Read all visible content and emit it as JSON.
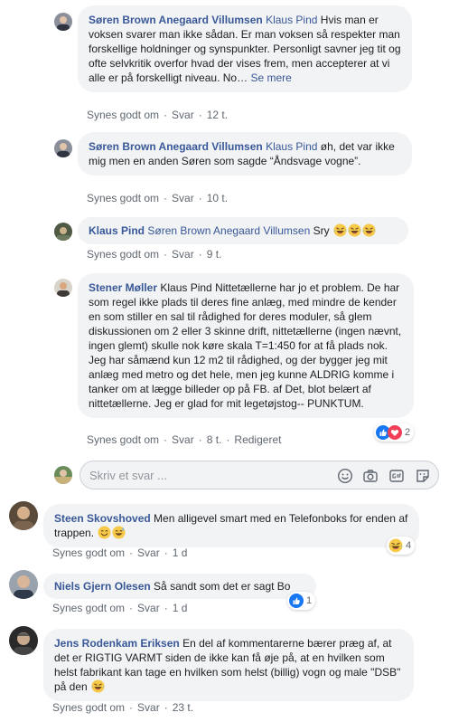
{
  "comments": [
    {
      "author": "Søren Brown Anegaard Villumsen",
      "mention": "Klaus Pind",
      "text": " Hvis man er voksen svarer man ikke sådan. Er man voksen så respekter man forskellige holdninger og synspunkter. Personligt savner jeg tit og ofte selvkritik overfor hvad der vises frem, men accepterer at vi alle er på forskelligt niveau. No…",
      "more": "Se mere",
      "like": "Synes godt om",
      "reply": "Svar",
      "time": "12 t."
    },
    {
      "author": "Søren Brown Anegaard Villumsen",
      "mention": "Klaus Pind",
      "text": " øh, det var ikke mig men en anden Søren som sagde “Åndsvage vogne”.",
      "like": "Synes godt om",
      "reply": "Svar",
      "time": "10 t."
    },
    {
      "author": "Klaus Pind",
      "mention": "Søren Brown Anegaard Villumsen",
      "text": " Sry",
      "like": "Synes godt om",
      "reply": "Svar",
      "time": "9 t."
    },
    {
      "author": "Stener Møller",
      "text": " Klaus Pind Nittetællerne har jo et problem. De har som regel ikke plads til deres fine anlæg, med mindre de kender en som stiller en sal til rådighed for deres moduler, så glem diskussionen om 2 eller 3 skinne drift, nittetællerne (ingen nævnt, ingen glemt) skulle nok køre skala T=1:450 for at få plads nok. Jeg har såmænd kun 12 m2 til rådighed, og der bygger jeg mit anlæg med metro og det hele, men jeg kunne ALDRIG komme i tanker om at lægge billeder op på FB. af Det, blot belært af nittetællerne. Jeg er glad for mit legetøjstog-- PUNKTUM.",
      "like": "Synes godt om",
      "reply": "Svar",
      "time": "8 t.",
      "edited": "Redigeret",
      "reactions": "2"
    },
    {
      "author": "Steen Skovshoved",
      "text": " Men alligevel smart med en Telefonboks for enden af trappen.",
      "like": "Synes godt om",
      "reply": "Svar",
      "time": "1 d",
      "reactions": "4"
    },
    {
      "author": "Niels Gjern Olesen",
      "text": " Så sandt som det er sagt Bo",
      "like": "Synes godt om",
      "reply": "Svar",
      "time": "1 d",
      "reactions": "1"
    },
    {
      "author": "Jens Rodenkam Eriksen",
      "text": " En del af kommentarerne bærer præg af, at det er RIGTIG VARMT siden de ikke kan få øje på, at en hvilken som helst fabrikant kan tage en hvilken som helst (billig) vogn og male \"DSB\" på den",
      "like": "Synes godt om",
      "reply": "Svar",
      "time": "23 t."
    }
  ],
  "reply_box": {
    "placeholder": "Skriv et svar ..."
  },
  "colors": {
    "link": "#385898",
    "bubble": "#f2f3f5",
    "meta": "#606770"
  }
}
